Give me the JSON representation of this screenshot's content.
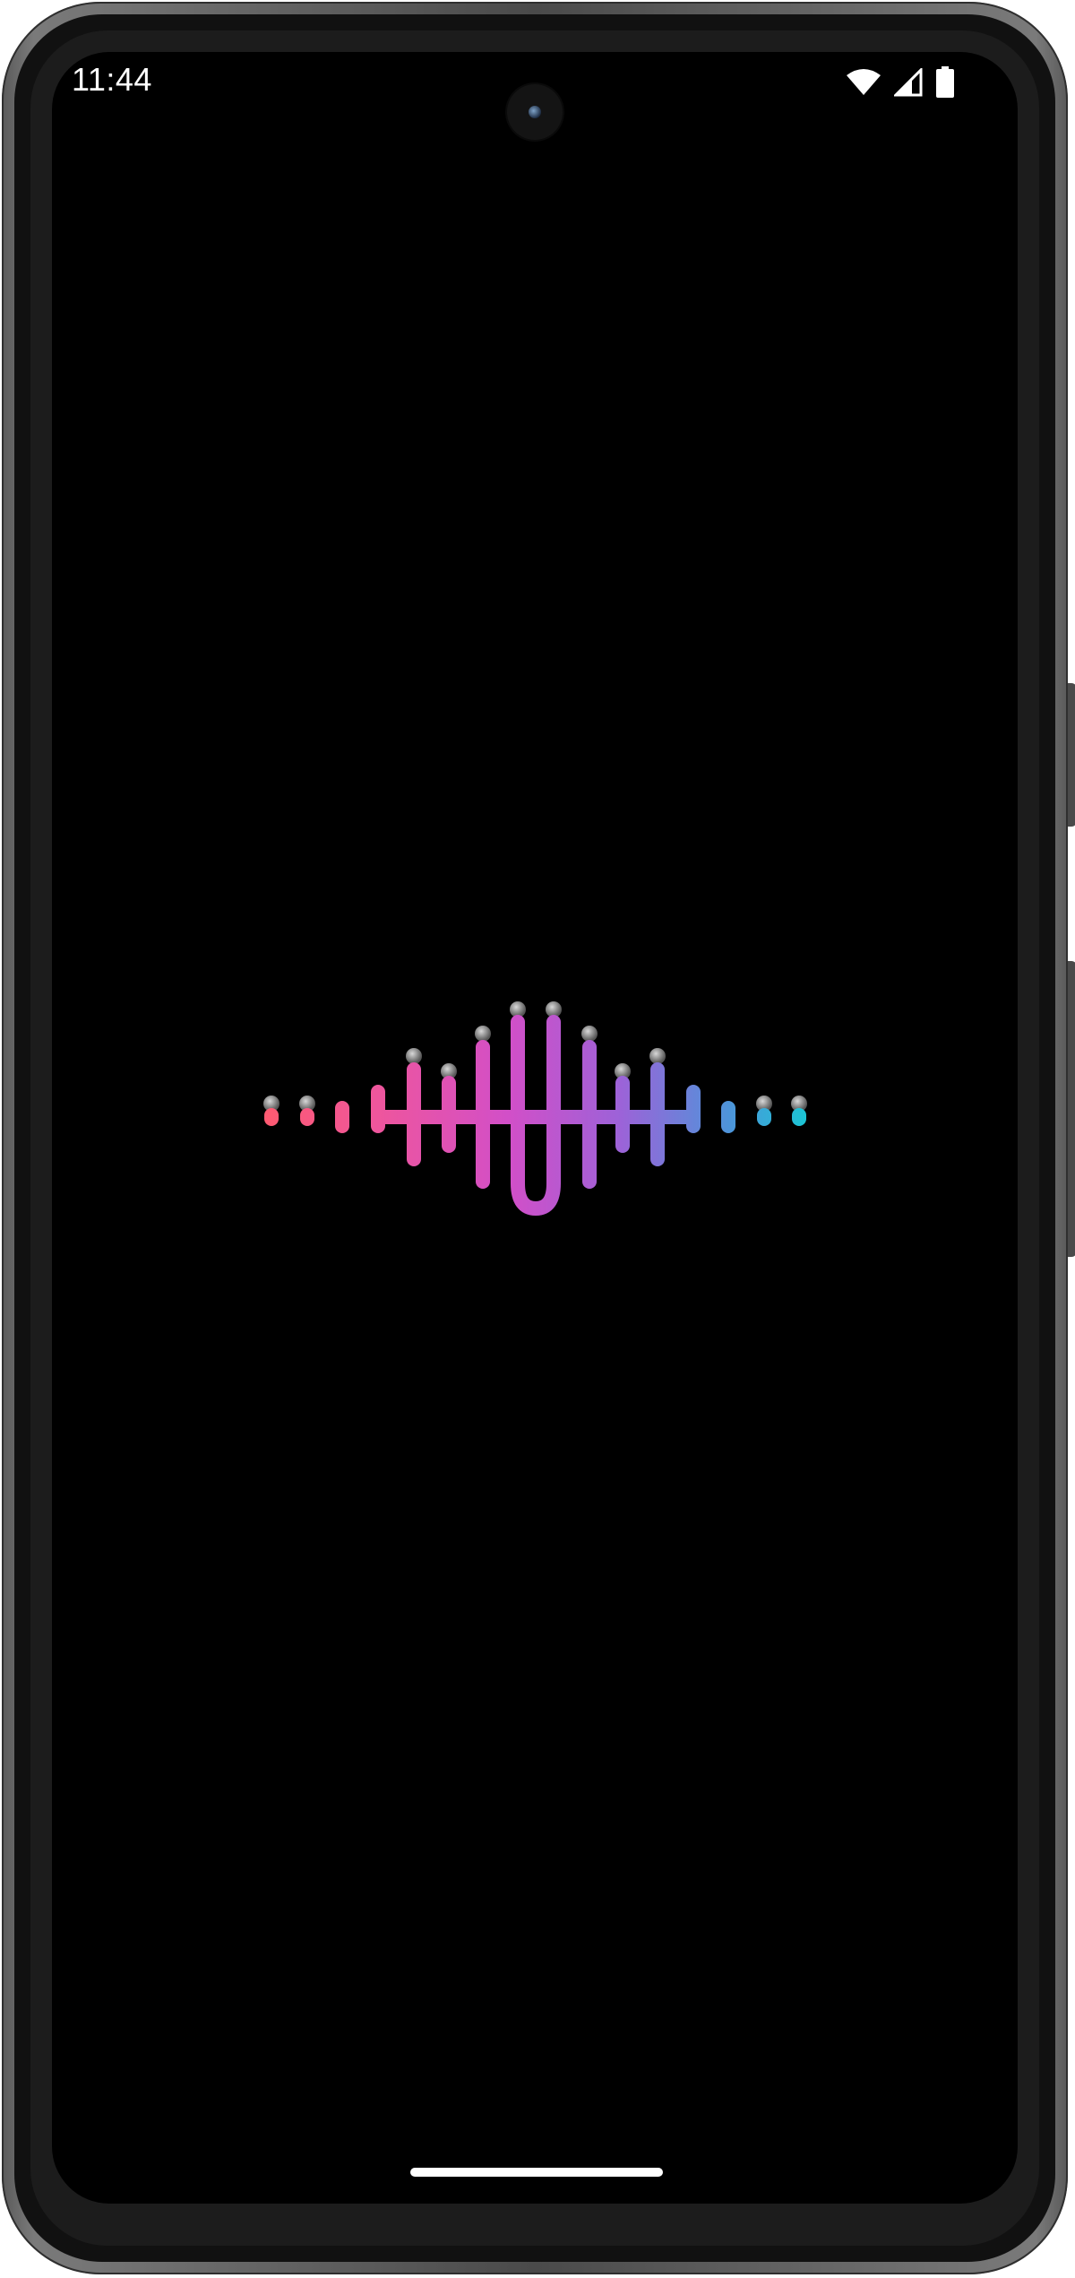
{
  "status_bar": {
    "time": "11:44",
    "icons": [
      "wifi-icon",
      "cellular-signal-icon",
      "battery-icon"
    ]
  },
  "splash": {
    "logo_icon": "audio-waveform-logo-icon",
    "gradient_colors": [
      "#ff5a6e",
      "#f0569a",
      "#d24fc8",
      "#9d62d8",
      "#5b8ad9",
      "#17c9d4"
    ]
  },
  "colors": {
    "background": "#000000",
    "status_text": "#ffffff"
  }
}
